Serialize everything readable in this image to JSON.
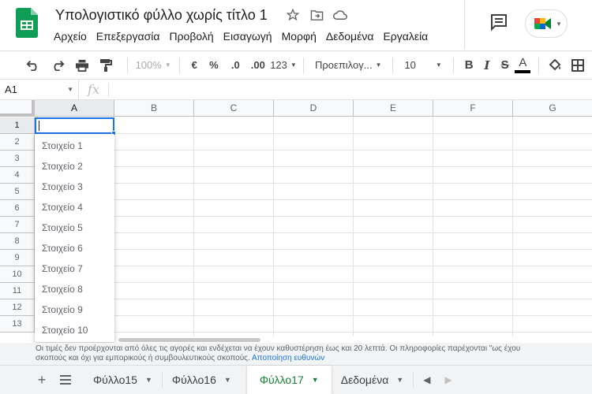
{
  "app": {
    "title": "Υπολογιστικό φύλλο χωρίς τίτλο 1"
  },
  "menu": [
    "Αρχείο",
    "Επεξεργασία",
    "Προβολή",
    "Εισαγωγή",
    "Μορφή",
    "Δεδομένα",
    "Εργαλεία"
  ],
  "toolbar": {
    "zoom": "100%",
    "currency": "€",
    "percent": "%",
    "decrease_decimals": ".0",
    "increase_decimals": ".00",
    "more_formats": "123",
    "font": "Προεπιλογ...",
    "font_size": "10",
    "bold": "B",
    "italic": "I",
    "strike": "S",
    "text_color": "A",
    "text_color_value": "#000000"
  },
  "formula_bar": {
    "cell_ref": "A1",
    "fx": "fx"
  },
  "grid": {
    "columns": [
      "A",
      "B",
      "C",
      "D",
      "E",
      "F",
      "G"
    ],
    "rows": [
      "1",
      "2",
      "3",
      "4",
      "5",
      "6",
      "7",
      "8",
      "9",
      "10",
      "11",
      "12",
      "13"
    ]
  },
  "dropdown": {
    "items": [
      "Στοιχείο 1",
      "Στοιχείο 2",
      "Στοιχείο 3",
      "Στοιχείο 4",
      "Στοιχείο 5",
      "Στοιχείο 6",
      "Στοιχείο 7",
      "Στοιχείο 8",
      "Στοιχείο 9",
      "Στοιχείο 10"
    ]
  },
  "footer": {
    "disclaimer_line1": "Οι τιμές δεν προέρχονται από όλες τις αγορές και ενδέχεται να έχουν καθυστέρηση έως και 20 λεπτά. Οι πληροφορίες παρέχονται \"ως έχου",
    "disclaimer_line2": "σκοπούς και όχι για εμπορικούς ή συμβουλευτικούς σκοπούς.",
    "disclaimer_link": "Αποποίηση ευθυνών"
  },
  "sheets": {
    "add": "+",
    "tabs": [
      "Φύλλο15",
      "Φύλλο16",
      "Φύλλο17",
      "Δεδομένα"
    ],
    "active_index": 2
  },
  "colors": {
    "accent": "#1a73e8",
    "sheets_green": "#188038"
  }
}
